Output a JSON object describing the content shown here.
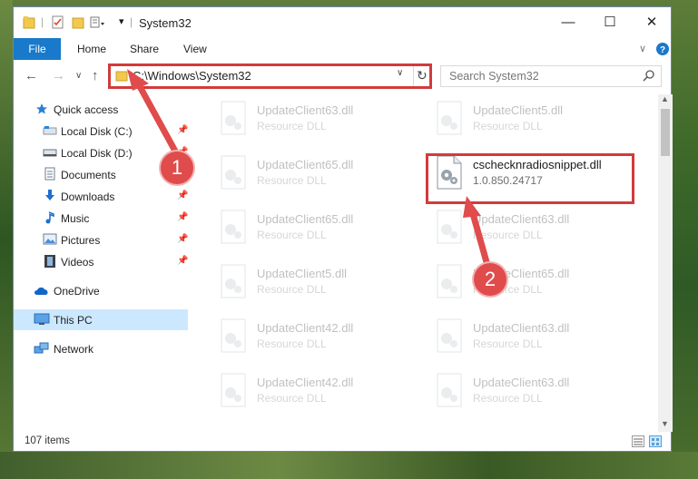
{
  "window": {
    "title": "System32"
  },
  "title_controls": {
    "minimize": "—",
    "maximize": "☐",
    "close": "✕"
  },
  "ribbon": {
    "tabs": [
      "File",
      "Home",
      "Share",
      "View"
    ]
  },
  "address": {
    "path": "C:\\Windows\\System32"
  },
  "search": {
    "placeholder": "Search System32"
  },
  "sidebar": {
    "items": [
      {
        "label": "Quick access",
        "icon": "star-icon",
        "pinned": false
      },
      {
        "label": "Local Disk (C:)",
        "icon": "drive-icon",
        "pinned": true
      },
      {
        "label": "Local Disk (D:)",
        "icon": "drive-icon",
        "pinned": true
      },
      {
        "label": "Documents",
        "icon": "documents-icon",
        "pinned": true
      },
      {
        "label": "Downloads",
        "icon": "download-icon",
        "pinned": true
      },
      {
        "label": "Music",
        "icon": "music-icon",
        "pinned": true
      },
      {
        "label": "Pictures",
        "icon": "pictures-icon",
        "pinned": true
      },
      {
        "label": "Videos",
        "icon": "videos-icon",
        "pinned": true
      },
      {
        "label": "OneDrive",
        "icon": "cloud-icon",
        "pinned": false
      },
      {
        "label": "This PC",
        "icon": "pc-icon",
        "pinned": false,
        "selected": true
      },
      {
        "label": "Network",
        "icon": "network-icon",
        "pinned": false
      }
    ]
  },
  "files": {
    "left": [
      {
        "name": "UpdateClient63.dll",
        "type": "Resource DLL"
      },
      {
        "name": "UpdateClient65.dll",
        "type": "Resource DLL"
      },
      {
        "name": "UpdateClient65.dll",
        "type": "Resource DLL"
      },
      {
        "name": "UpdateClient5.dll",
        "type": "Resource DLL"
      },
      {
        "name": "UpdateClient42.dll",
        "type": "Resource DLL"
      },
      {
        "name": "UpdateClient42.dll",
        "type": "Resource DLL"
      }
    ],
    "right": [
      {
        "name": "UpdateClient5.dll",
        "type": "Resource DLL"
      },
      {
        "name": "cschecknradiosnippet.dll",
        "type": "1.0.850.24717",
        "highlighted": true
      },
      {
        "name": "UpdateClient63.dll",
        "type": "Resource DLL"
      },
      {
        "name": "UpdateClient65.dll",
        "type": "Resource DLL"
      },
      {
        "name": "UpdateClient63.dll",
        "type": "Resource DLL"
      },
      {
        "name": "UpdateClient63.dll",
        "type": "Resource DLL"
      }
    ]
  },
  "status": {
    "item_count": "107 items"
  },
  "annotations": {
    "badge1": "1",
    "badge2": "2",
    "color": "#d23b3b"
  }
}
